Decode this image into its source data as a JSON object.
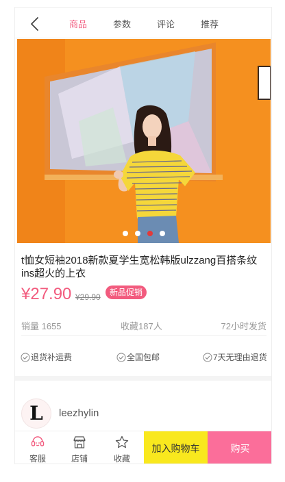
{
  "nav": {
    "tabs": [
      {
        "label": "商品",
        "active": true
      },
      {
        "label": "参数",
        "active": false
      },
      {
        "label": "评论",
        "active": false
      },
      {
        "label": "推荐",
        "active": false
      }
    ],
    "back_icon": "chevron-left-icon"
  },
  "gallery": {
    "image": "model-in-yellow-striped-tshirt",
    "dots": 4,
    "active_dot": 3
  },
  "product": {
    "title": "t恤女短袖2018新款夏学生宽松韩版ulzzang百搭条纹ins超火的上衣",
    "price": "¥27.90",
    "old_price": "¥29.90",
    "promo_badge": "新品促销"
  },
  "stats": {
    "sales": "销量 1655",
    "favorites": "收藏187人",
    "shipping": "72小时发货"
  },
  "guarantees": [
    {
      "label": "退货补运费",
      "icon": "check-circle-icon"
    },
    {
      "label": "全国包邮",
      "icon": "check-circle-icon"
    },
    {
      "label": "7天无理由退货",
      "icon": "check-circle-icon"
    }
  ],
  "shop": {
    "logo_letter": "L",
    "name": "leezhylin"
  },
  "bottom_bar": {
    "service": "客服",
    "store": "店铺",
    "favorite": "收藏",
    "add_to_cart": "加入购物车",
    "buy": "购买"
  },
  "colors": {
    "accent": "#f25b7e",
    "cart": "#f9e81e",
    "buy": "#fb6e9a",
    "dot_active": "#e23a3a"
  }
}
